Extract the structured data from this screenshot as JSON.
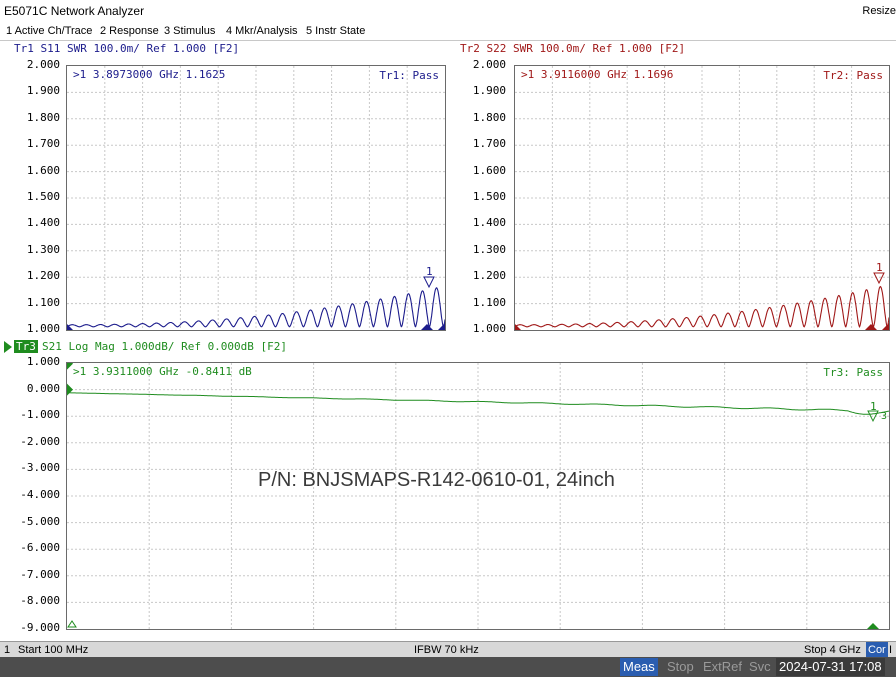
{
  "window": {
    "title": "E5071C Network Analyzer",
    "resize_label": "Resize"
  },
  "menu": [
    "1 Active Ch/Trace",
    "2 Response",
    "3 Stimulus",
    "4 Mkr/Analysis",
    "5 Instr State"
  ],
  "colors": {
    "tr1": "#1c1c8c",
    "tr2": "#a01818",
    "tr3": "#1f8c1f",
    "grid": "#c8c8c8"
  },
  "trace1": {
    "header": "Tr1 S11 SWR 100.0m/ Ref 1.000 [F2]",
    "marker_readout": ">1  3.8973000 GHz  1.1625",
    "status": "Tr1: Pass",
    "y_ticks": [
      "2.000",
      "1.900",
      "1.800",
      "1.700",
      "1.600",
      "1.500",
      "1.400",
      "1.300",
      "1.200",
      "1.100",
      "1.000"
    ],
    "marker_label": "1"
  },
  "trace2": {
    "header": "Tr2 S22 SWR 100.0m/ Ref 1.000 [F2]",
    "marker_readout": ">1  3.9116000 GHz  1.1696",
    "status": "Tr2: Pass",
    "y_ticks": [
      "2.000",
      "1.900",
      "1.800",
      "1.700",
      "1.600",
      "1.500",
      "1.400",
      "1.300",
      "1.200",
      "1.100",
      "1.000"
    ],
    "marker_label": "1"
  },
  "trace3": {
    "badge": "Tr3",
    "header": "S21 Log Mag 1.000dB/ Ref 0.000dB [F2]",
    "marker_readout": ">1  3.9311000 GHz -0.8411 dB",
    "status": "Tr3: Pass",
    "y_ticks": [
      "1.000",
      "0.000",
      "-1.000",
      "-2.000",
      "-3.000",
      "-4.000",
      "-5.000",
      "-6.000",
      "-7.000",
      "-8.000",
      "-9.000"
    ],
    "marker_label": "1",
    "end_label": "3"
  },
  "overlay_text": "P/N: BNJSMAPS-R142-0610-01, 24inch",
  "status_bar": {
    "channel": "1",
    "start": "Start 100 MHz",
    "ifbw": "IFBW 70 kHz",
    "stop": "Stop 4 GHz",
    "cor": "Cor",
    "tail": "I"
  },
  "bottom_bar": {
    "meas": "Meas",
    "stop": "Stop",
    "extref": "ExtRef",
    "svc": "Svc",
    "datetime": "2024-07-31 17:08"
  }
}
